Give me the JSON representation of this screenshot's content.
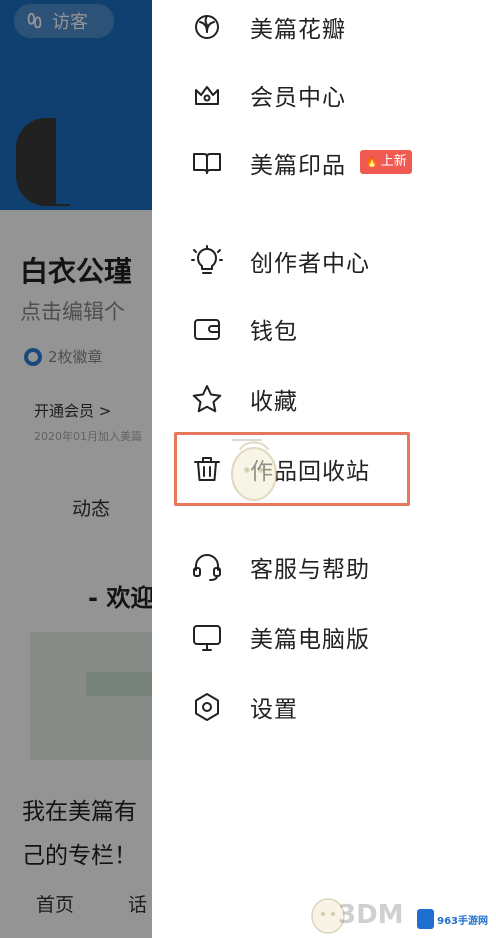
{
  "background_page": {
    "visitor_label": "访客",
    "user_name": "白衣公瑾",
    "edit_prompt": "点击编辑个",
    "badge_text": "2枚徽章",
    "member_link": "开通会员 >",
    "member_sub": "2020年01月加入美篇",
    "tab_label": "动态",
    "welcome_text": "- 欢迎",
    "article_line1": "我在美篇有",
    "article_line2": "己的专栏！",
    "nav_home": "首页",
    "nav_topic": "话"
  },
  "drawer": {
    "items": [
      {
        "label": "美篇花瓣",
        "icon": "flower-icon"
      },
      {
        "label": "会员中心",
        "icon": "crown-icon"
      },
      {
        "label": "美篇印品",
        "icon": "book-icon",
        "badge": "上新"
      },
      {
        "label": "创作者中心",
        "icon": "lightbulb-icon"
      },
      {
        "label": "钱包",
        "icon": "wallet-icon"
      },
      {
        "label": "收藏",
        "icon": "star-icon"
      },
      {
        "label": "作品回收站",
        "icon": "trash-icon",
        "highlighted": true
      },
      {
        "label": "客服与帮助",
        "icon": "headset-icon"
      },
      {
        "label": "美篇电脑版",
        "icon": "monitor-icon"
      },
      {
        "label": "设置",
        "icon": "settings-icon"
      }
    ]
  },
  "colors": {
    "banner": "#1d6fc2",
    "badge_red": "#f05a50",
    "highlight_border": "#e4775c"
  },
  "watermark": {
    "brand": "3DM",
    "site": "963手游网"
  }
}
